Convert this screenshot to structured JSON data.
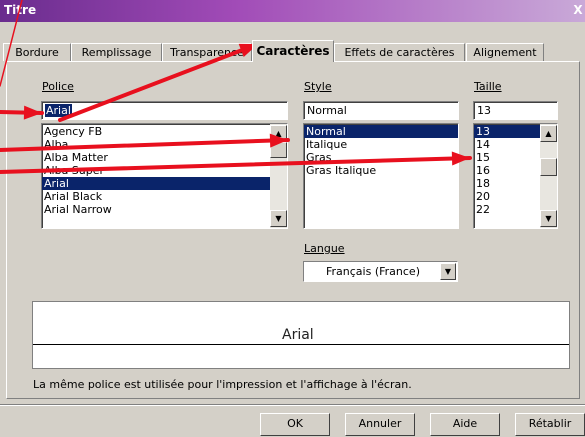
{
  "window": {
    "title": "Titre",
    "close_label": "X"
  },
  "tabs": [
    {
      "label": "Bordure"
    },
    {
      "label": "Remplissage"
    },
    {
      "label": "Transparence"
    },
    {
      "label": "Caractères",
      "active": true
    },
    {
      "label": "Effets de caractères"
    },
    {
      "label": "Alignement"
    }
  ],
  "police": {
    "label": "Police",
    "value": "Arial",
    "items": [
      "Agency FB",
      "Alba",
      "Alba Matter",
      "Alba Super",
      "Arial",
      "Arial Black",
      "Arial Narrow"
    ],
    "selected": "Arial"
  },
  "style": {
    "label": "Style",
    "value": "Normal",
    "items": [
      "Normal",
      "Italique",
      "Gras",
      "Gras Italique"
    ],
    "selected": "Normal"
  },
  "taille": {
    "label": "Taille",
    "value": "13",
    "items": [
      "13",
      "14",
      "15",
      "16",
      "18",
      "20",
      "22"
    ],
    "selected": "13"
  },
  "langue": {
    "label": "Langue",
    "value": "Français (France)"
  },
  "preview": {
    "text": "Arial"
  },
  "info_text": "La même police est utilisée pour l'impression et l'affichage à l'écran.",
  "buttons": {
    "ok": "OK",
    "cancel": "Annuler",
    "help": "Aide",
    "reset": "Rétablir"
  },
  "annotation_color": "#e8101e"
}
